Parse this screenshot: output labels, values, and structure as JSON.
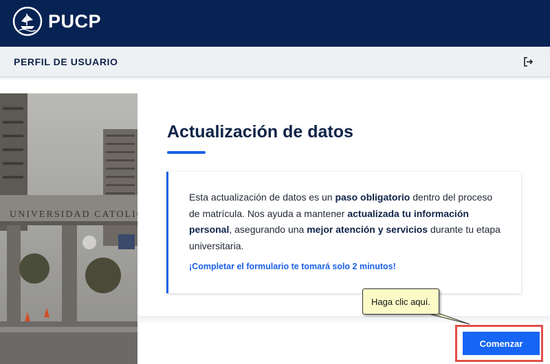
{
  "brand": {
    "logo_text": "PUCP"
  },
  "profile": {
    "title": "PERFIL DE USUARIO"
  },
  "main": {
    "title": "Actualización de datos",
    "body_parts": [
      {
        "text": "Esta actualización de datos es un ",
        "bold": false
      },
      {
        "text": "paso obligatorio",
        "bold": true
      },
      {
        "text": " dentro del proceso de matrícula. Nos ayuda a mantener ",
        "bold": false
      },
      {
        "text": "actualizada tu información personal",
        "bold": true
      },
      {
        "text": ", asegurando una ",
        "bold": false
      },
      {
        "text": "mejor atención y servicios",
        "bold": true
      },
      {
        "text": " durante tu etapa universitaria.",
        "bold": false
      }
    ],
    "note": "¡Completar el formulario te tomará solo 2 minutos!"
  },
  "start_button": {
    "label": "Comenzar"
  },
  "tooltip": {
    "text": "Haga clic aquí."
  },
  "photo": {
    "sign_text": "UNIVERSIDAD CATOLICA DEL"
  },
  "colors": {
    "brand_navy": "#072353",
    "accent_blue": "#1665f4",
    "highlight_red": "#e2504a",
    "tooltip_bg": "#fcfbc8"
  },
  "icons": {
    "logout": "logout-icon",
    "seal": "pucp-seal-icon"
  }
}
